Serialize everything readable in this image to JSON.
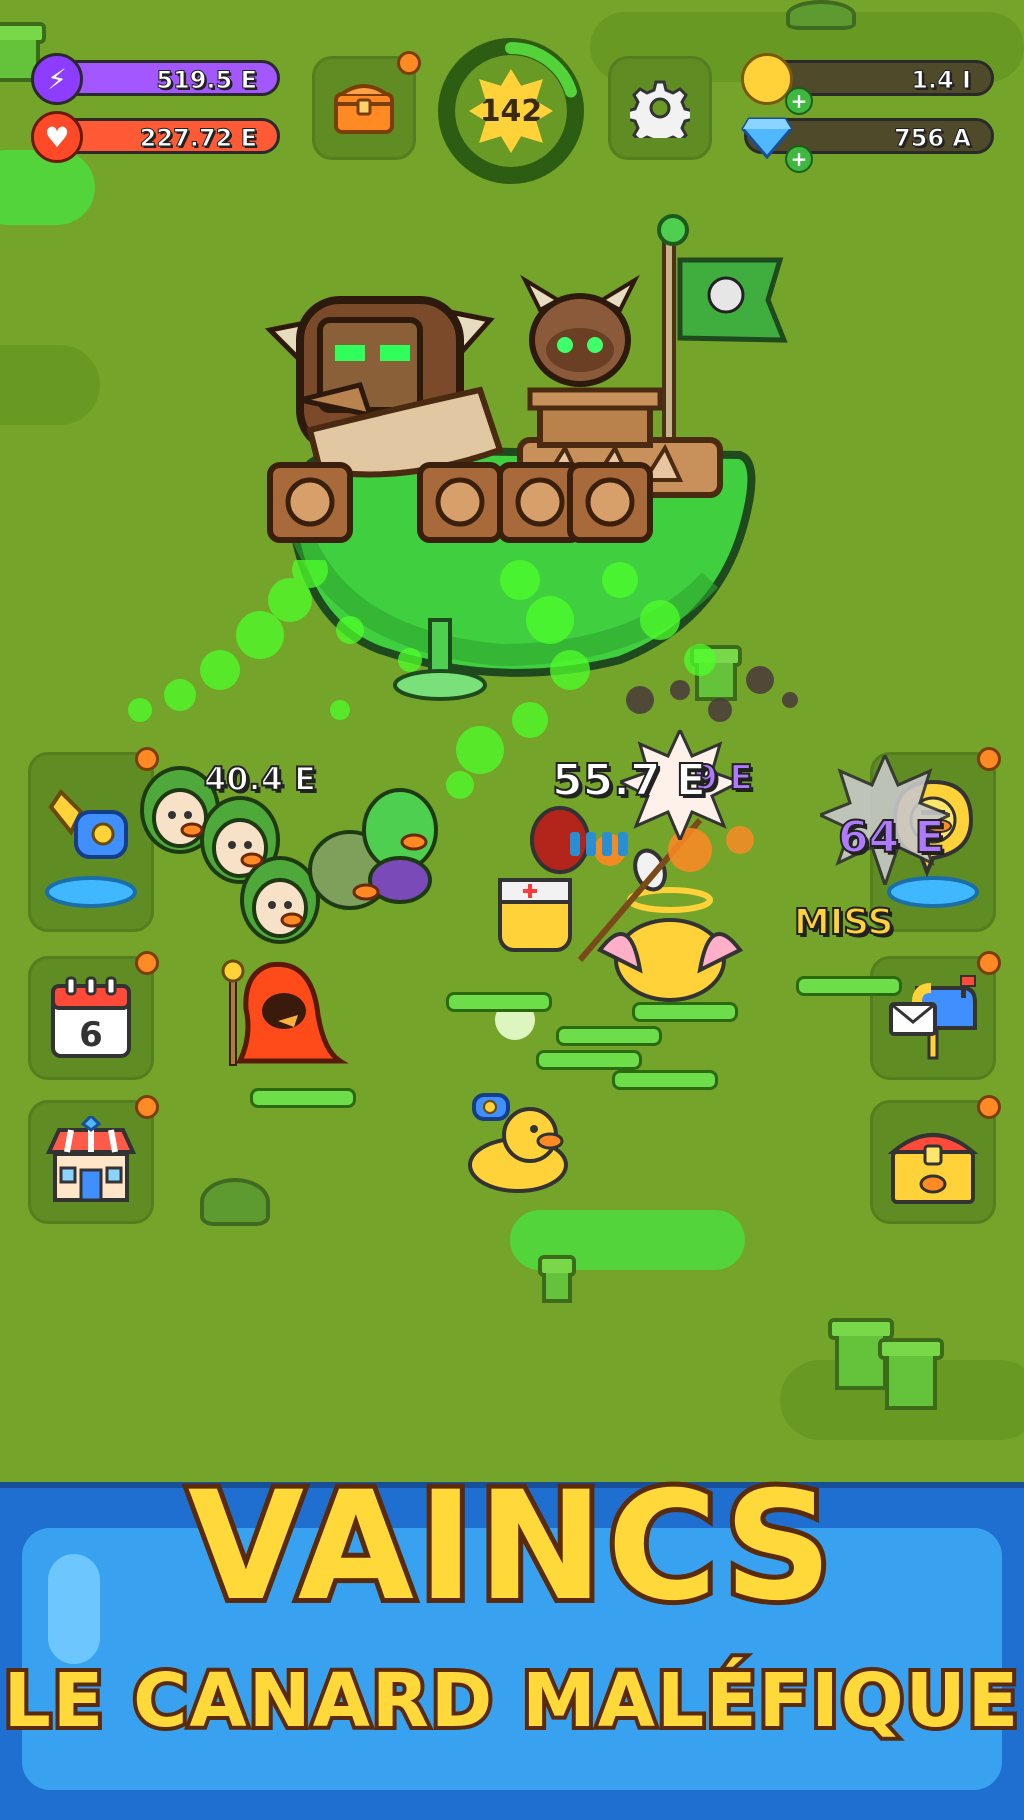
{
  "hud": {
    "energy": {
      "value": "519.5 E",
      "icon": "lightning-icon",
      "color": "#9b4dff"
    },
    "health": {
      "value": "227.72 E",
      "icon": "heart-icon",
      "color": "#ff4b33"
    },
    "level": {
      "value": "142",
      "progress": 0.2
    },
    "coins": {
      "value": "1.4 I",
      "icon": "coin-icon"
    },
    "gems": {
      "value": "756 A",
      "icon": "diamond-icon"
    }
  },
  "left_buttons": [
    {
      "name": "horn-button",
      "icon": "horn-icon"
    },
    {
      "name": "calendar-button",
      "icon": "calendar-icon",
      "label": "6"
    },
    {
      "name": "shop-button",
      "icon": "shop-icon"
    }
  ],
  "right_buttons": [
    {
      "name": "duck-shout-button",
      "icon": "duck-shout-icon"
    },
    {
      "name": "mailbox-button",
      "icon": "mailbox-icon"
    },
    {
      "name": "treasure-chest-button",
      "icon": "treasure-chest-icon"
    }
  ],
  "damage_numbers": {
    "left": "40.4 E",
    "center": "55.7 E",
    "center_behind": "9 E",
    "right": "64 E",
    "miss": "MISS"
  },
  "banner": {
    "title": "VAINCS",
    "subtitle": "LE CANARD MALÉFIQUE"
  },
  "colors": {
    "grass": "#74a429",
    "goo": "#52d43a",
    "banner_blue": "#1f6fd0",
    "title_yellow": "#ffd93a"
  }
}
